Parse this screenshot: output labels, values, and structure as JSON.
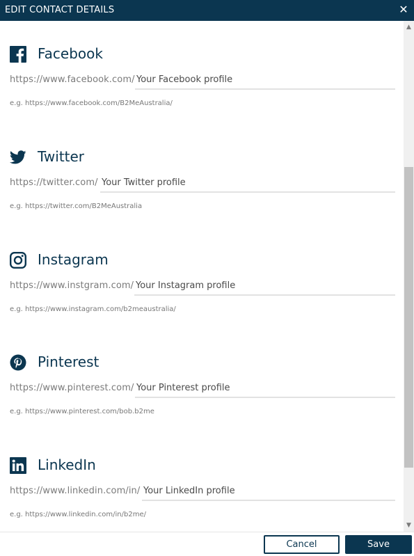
{
  "dialog": {
    "title": "EDIT CONTACT DETAILS",
    "close_glyph": "✕"
  },
  "sections": [
    {
      "name": "Facebook",
      "icon": "facebook-icon",
      "prefix": "https://www.facebook.com/",
      "placeholder": "Your Facebook profile",
      "value": "",
      "example": "e.g. https://www.facebook.com/B2MeAustralia/"
    },
    {
      "name": "Twitter",
      "icon": "twitter-icon",
      "prefix": "https://twitter.com/",
      "placeholder": "Your Twitter profile",
      "value": "",
      "example": "e.g. https://twitter.com/B2MeAustralia"
    },
    {
      "name": "Instagram",
      "icon": "instagram-icon",
      "prefix": "https://www.instgram.com/",
      "placeholder": "Your Instagram profile",
      "value": "",
      "example": "e.g. https://www.instagram.com/b2meaustralia/"
    },
    {
      "name": "Pinterest",
      "icon": "pinterest-icon",
      "prefix": "https://www.pinterest.com/",
      "placeholder": "Your Pinterest profile",
      "value": "",
      "example": "e.g. https://www.pinterest.com/bob.b2me"
    },
    {
      "name": "LinkedIn",
      "icon": "linkedin-icon",
      "prefix": "https://www.linkedin.com/in/",
      "placeholder": "Your LinkedIn profile",
      "value": "",
      "example": "e.g. https://www.linkedin.com/in/b2me/"
    }
  ],
  "scrollbar": {
    "up_glyph": "▲",
    "down_glyph": "▼"
  },
  "footer": {
    "cancel_label": "Cancel",
    "save_label": "Save"
  },
  "colors": {
    "brand": "#0b3650",
    "muted_text": "#7a7a7a",
    "input_underline": "#e2e2e2"
  }
}
